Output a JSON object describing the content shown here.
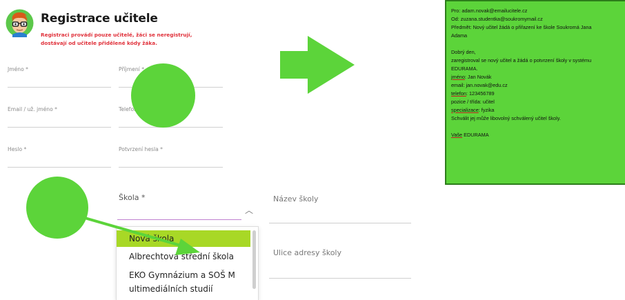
{
  "header": {
    "title": "Registrace učitele",
    "notice_line1": "Registraci provádí pouze učitelé, žáci se neregistrují,",
    "notice_line2": "dostávají od učitele přidělené kódy žáka."
  },
  "form": {
    "first_name_label": "Jméno *",
    "last_name_label": "Příjmení *",
    "email_label": "Email / už. jméno *",
    "phone_label": "Telefon *",
    "password_label": "Heslo *",
    "password_confirm_label": "Potvrzení hesla *",
    "school_label": "Škola *",
    "school_name_label": "Název školy",
    "school_street_label": "Ulice adresy školy"
  },
  "dropdown": {
    "options": [
      "Nová škola",
      "Albrechtova střední škola",
      "EKO Gymnázium a SOŠ M",
      "ultimediálních studií"
    ],
    "selected": "Nová škola"
  },
  "email": {
    "to": "Pro: adam.novak@emailucitele.cz",
    "from": "Od: zuzana.studentka@soukromymail.cz",
    "subject_line1": "Předmět: Nový učitel žádá o přiřazení ke škole Soukromá Jana",
    "subject_line2": "Adama",
    "greeting": "Dobrý den,",
    "body_line1": "zaregistroval se nový učitel a žádá o potvrzení školy v systému",
    "body_line2": "EDURAMA.",
    "name_key": "jméno",
    "name_value": ": Jan Novák",
    "email_line": "email: jan.novak@edu.cz",
    "phone_key": "telefon",
    "phone_value": ": 123456789",
    "position_line": "pozice / třída: učitel",
    "spec_key": "specializace",
    "spec_value": ": fyzika",
    "approve_line": "Schválit jej může libovolný schválený učitel školy.",
    "signoff_key": "Vaše",
    "signoff_value": " EDURAMA"
  },
  "colors": {
    "accent_green": "#5cd43a",
    "selected_option": "#a8d826",
    "notice_red": "#e0303a"
  }
}
